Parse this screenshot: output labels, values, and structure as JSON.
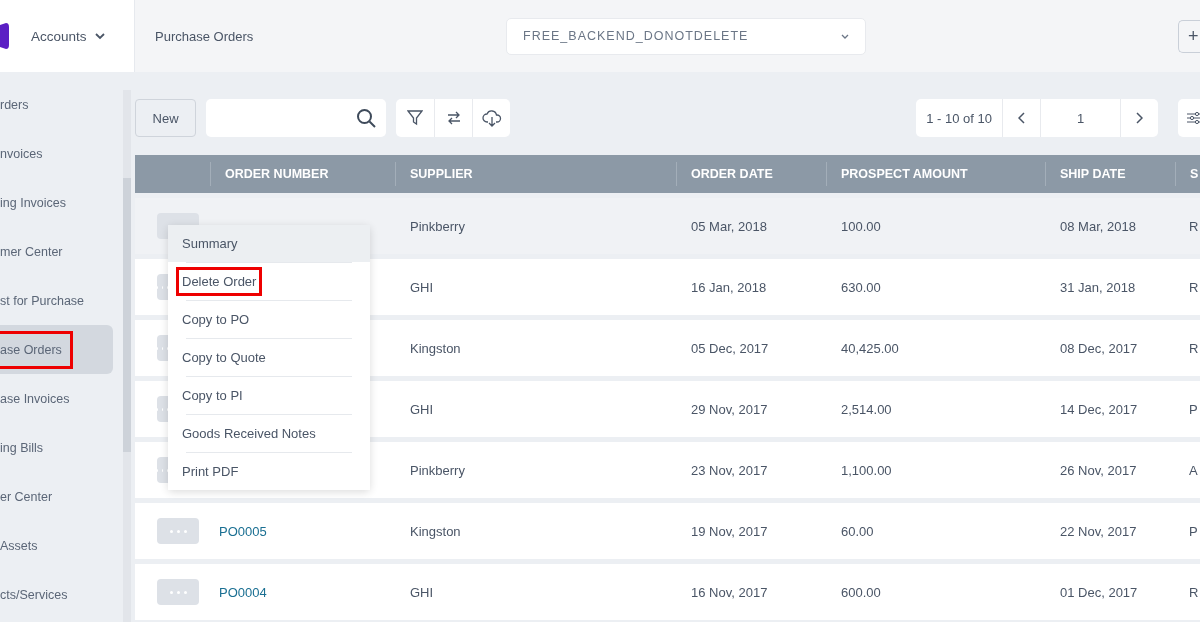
{
  "app": {
    "module": "Accounts"
  },
  "breadcrumb": "Purchase Orders",
  "company_select": {
    "value": "FREE_BACKEND_DONOTDELETE"
  },
  "add_button": "+",
  "sidebar": {
    "items": [
      {
        "label": "rders",
        "selected": false,
        "highlighted": false
      },
      {
        "label": "nvoices",
        "selected": false,
        "highlighted": false
      },
      {
        "label": "ing Invoices",
        "selected": false,
        "highlighted": false
      },
      {
        "label": "mer Center",
        "selected": false,
        "highlighted": false
      },
      {
        "label": "st for Purchase",
        "selected": false,
        "highlighted": false
      },
      {
        "label": "ase Orders",
        "selected": true,
        "highlighted": true
      },
      {
        "label": "ase Invoices",
        "selected": false,
        "highlighted": false
      },
      {
        "label": "ing Bills",
        "selected": false,
        "highlighted": false
      },
      {
        "label": "er Center",
        "selected": false,
        "highlighted": false
      },
      {
        "label": "Assets",
        "selected": false,
        "highlighted": false
      },
      {
        "label": "cts/Services",
        "selected": false,
        "highlighted": false
      }
    ]
  },
  "toolbar": {
    "new_button": "New",
    "pagination": {
      "range": "1 - 10 of 10",
      "page": "1"
    }
  },
  "table": {
    "columns": [
      "ORDER NUMBER",
      "SUPPLIER",
      "ORDER DATE",
      "PROSPECT AMOUNT",
      "SHIP DATE",
      "S"
    ],
    "rows": [
      {
        "supplier": "Pinkberry",
        "order_date": "05 Mar, 2018",
        "amount": "100.00",
        "ship_date": "08 Mar, 2018",
        "status": "R",
        "hovered": true
      },
      {
        "supplier": "GHI",
        "order_date": "16 Jan, 2018",
        "amount": "630.00",
        "ship_date": "31 Jan, 2018",
        "status": "R",
        "hovered": false
      },
      {
        "supplier": "Kingston",
        "order_date": "05 Dec, 2017",
        "amount": "40,425.00",
        "ship_date": "08 Dec, 2017",
        "status": "R",
        "hovered": false
      },
      {
        "supplier": "GHI",
        "order_date": "29 Nov, 2017",
        "amount": "2,514.00",
        "ship_date": "14 Dec, 2017",
        "status": "P",
        "hovered": false
      },
      {
        "supplier": "Pinkberry",
        "order_date": "23 Nov, 2017",
        "amount": "1,100.00",
        "ship_date": "26 Nov, 2017",
        "status": "A",
        "hovered": false
      },
      {
        "order_number": "PO0005",
        "supplier": "Kingston",
        "order_date": "19 Nov, 2017",
        "amount": "60.00",
        "ship_date": "22 Nov, 2017",
        "status": "P",
        "hovered": false
      },
      {
        "order_number": "PO0004",
        "supplier": "GHI",
        "order_date": "16 Nov, 2017",
        "amount": "600.00",
        "ship_date": "01 Dec, 2017",
        "status": "R",
        "hovered": false
      }
    ]
  },
  "row_menu": {
    "items": [
      {
        "label": "Summary",
        "hovered": true,
        "highlighted": false
      },
      {
        "label": "Delete Order",
        "hovered": false,
        "highlighted": true
      },
      {
        "label": "Copy to PO",
        "hovered": false,
        "highlighted": false
      },
      {
        "label": "Copy to Quote",
        "hovered": false,
        "highlighted": false
      },
      {
        "label": "Copy to PI",
        "hovered": false,
        "highlighted": false
      },
      {
        "label": "Goods Received Notes",
        "hovered": false,
        "highlighted": false
      },
      {
        "label": "Print PDF",
        "hovered": false,
        "highlighted": false
      }
    ]
  }
}
